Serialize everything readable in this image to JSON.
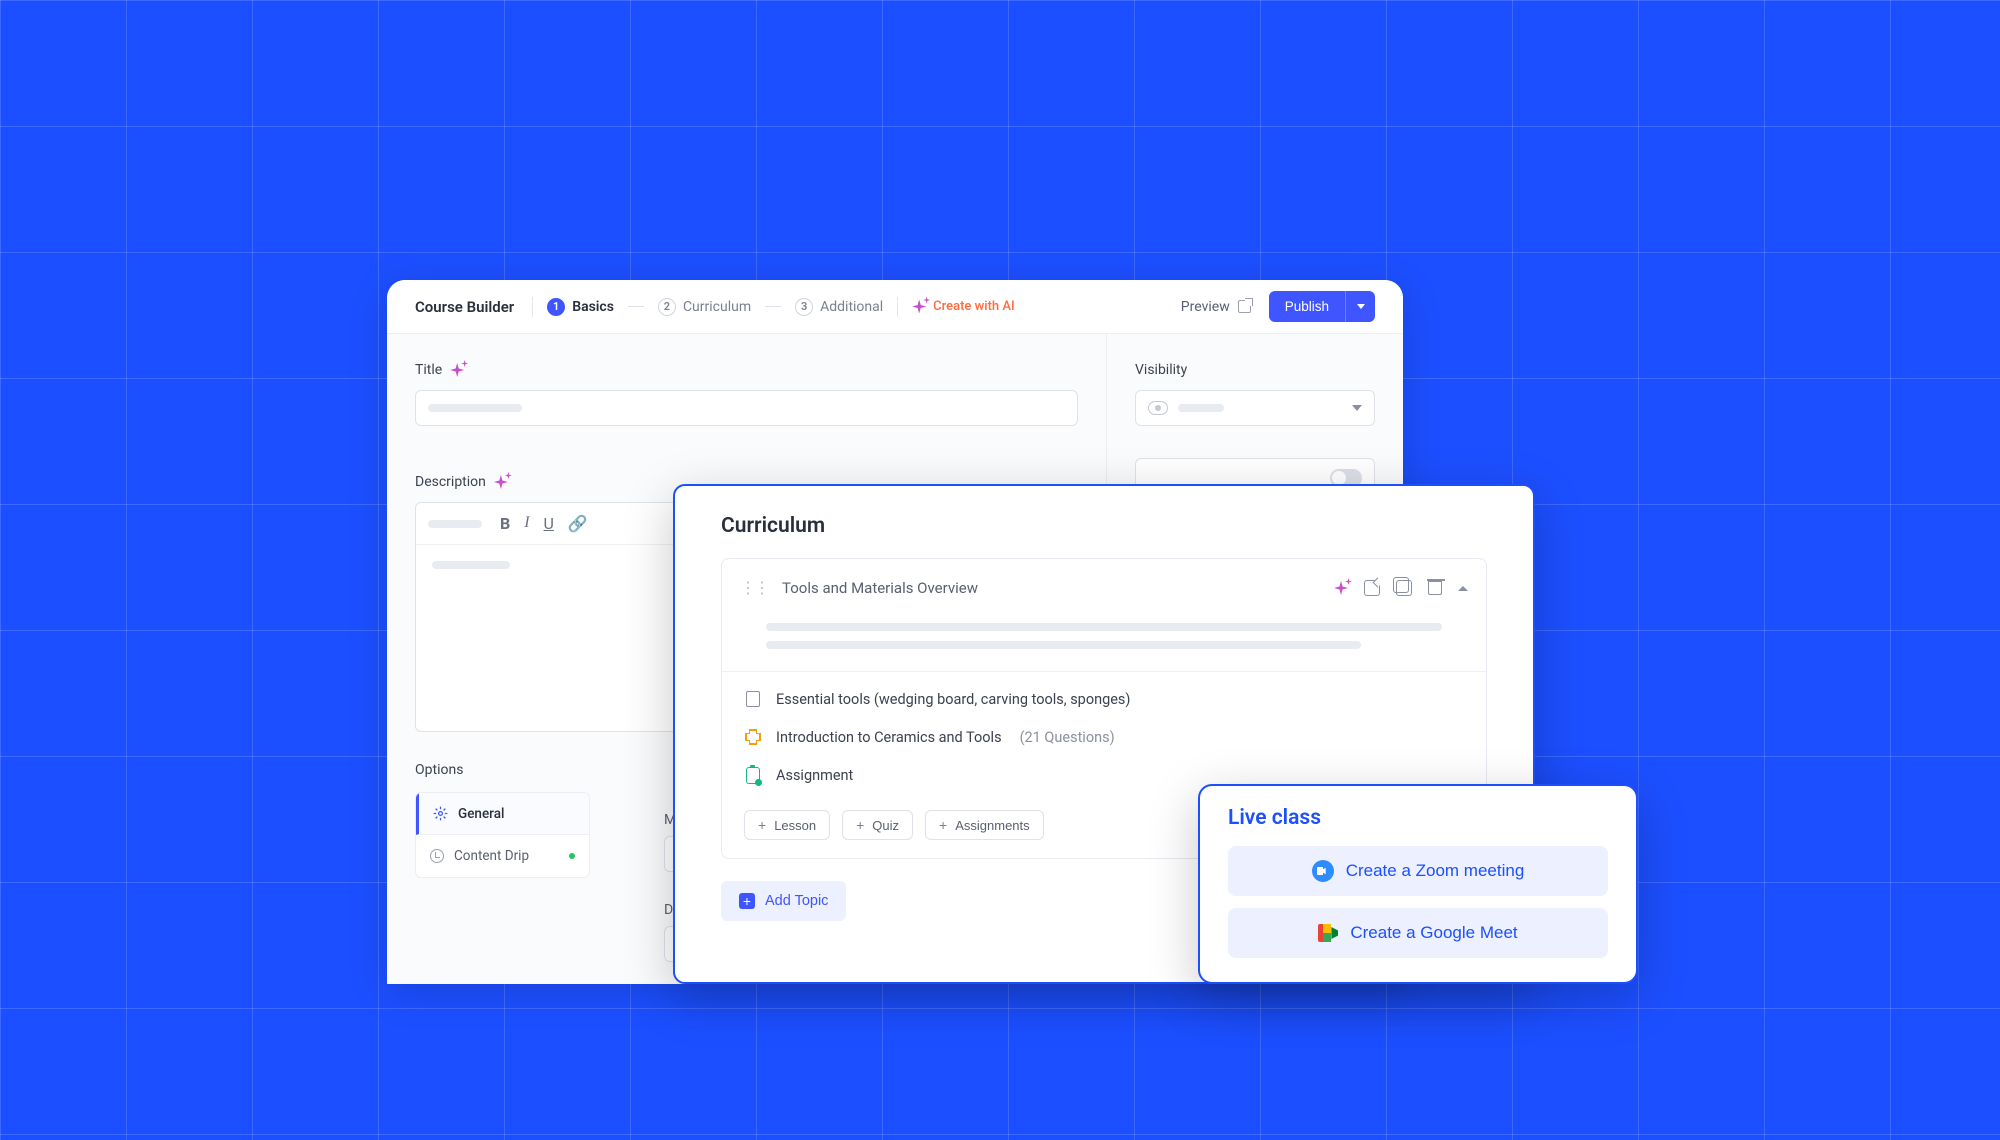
{
  "header": {
    "app_title": "Course Builder",
    "steps": [
      {
        "num": "1",
        "label": "Basics",
        "active": true
      },
      {
        "num": "2",
        "label": "Curriculum",
        "active": false
      },
      {
        "num": "3",
        "label": "Additional",
        "active": false
      }
    ],
    "create_ai": "Create with AI",
    "preview": "Preview",
    "publish": "Publish"
  },
  "basics": {
    "title_label": "Title",
    "description_label": "Description",
    "options_label": "Options",
    "option_tabs": {
      "general": "General",
      "content_drip": "Content Drip"
    },
    "extra_m": "M",
    "extra_d": "D"
  },
  "sidebar": {
    "visibility_label": "Visibility"
  },
  "curriculum": {
    "title": "Curriculum",
    "topic": {
      "name": "Tools and Materials Overview",
      "lessons": [
        {
          "kind": "lesson",
          "title": "Essential tools (wedging board, carving tools, sponges)"
        },
        {
          "kind": "quiz",
          "title": "Introduction to Ceramics and Tools",
          "meta": "(21 Questions)"
        },
        {
          "kind": "assignment",
          "title": "Assignment"
        }
      ],
      "add_buttons": {
        "lesson": "Lesson",
        "quiz": "Quiz",
        "assignments": "Assignments"
      }
    },
    "add_topic": "Add Topic"
  },
  "live": {
    "title": "Live class",
    "zoom": "Create a Zoom meeting",
    "google": "Create a Google Meet"
  }
}
